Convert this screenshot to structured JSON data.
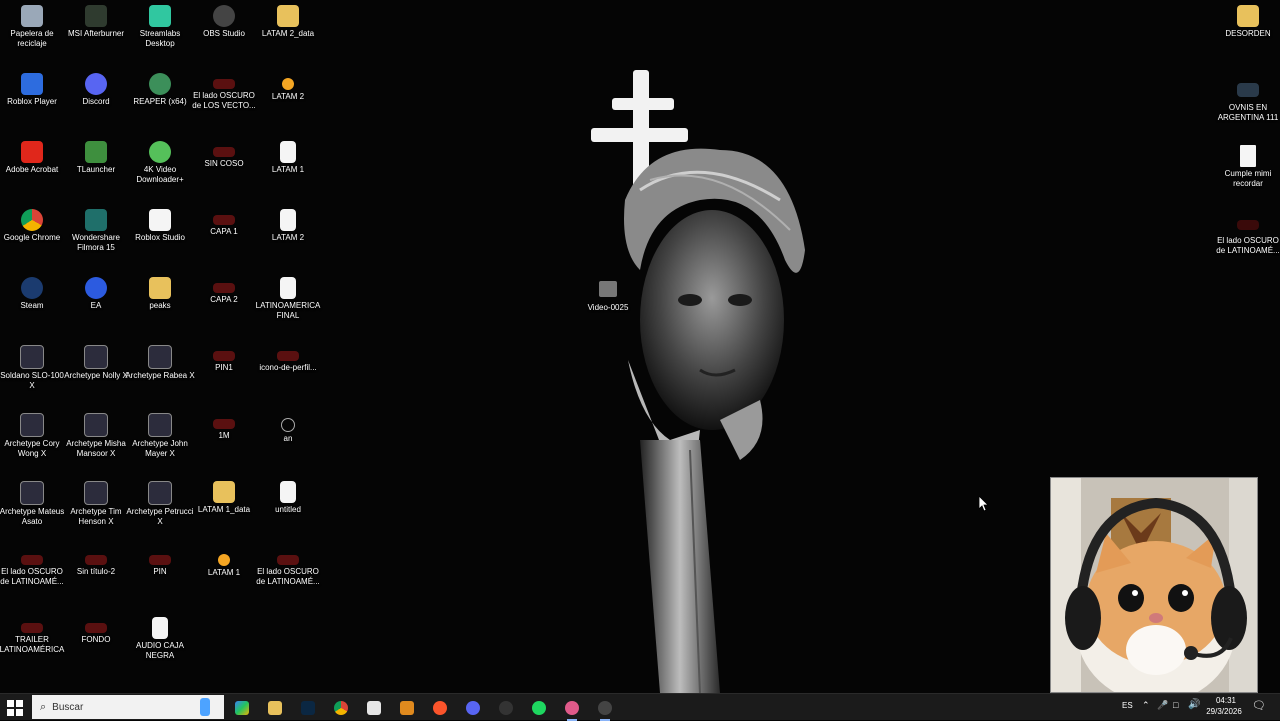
{
  "desktop": {
    "icons": [
      {
        "label": "Papelera de reciclaje",
        "icon": "recycle-bin-icon"
      },
      {
        "label": "MSI Afterburner",
        "icon": "afterburner-icon"
      },
      {
        "label": "Streamlabs Desktop",
        "icon": "streamlabs-icon"
      },
      {
        "label": "OBS Studio",
        "icon": "obs-icon"
      },
      {
        "label": "LATAM 2_data",
        "icon": "folder-icon"
      },
      {
        "label": "Roblox Player",
        "icon": "roblox-icon"
      },
      {
        "label": "Discord",
        "icon": "discord-icon"
      },
      {
        "label": "REAPER (x64)",
        "icon": "reaper-icon"
      },
      {
        "label": "El lado OSCURO de LOS VECTO...",
        "icon": "image-thumb-icon"
      },
      {
        "label": "LATAM 2",
        "icon": "project-icon"
      },
      {
        "label": "Adobe Acrobat",
        "icon": "acrobat-icon"
      },
      {
        "label": "TLauncher",
        "icon": "tlauncher-icon"
      },
      {
        "label": "4K Video Downloader+",
        "icon": "video-downloader-icon"
      },
      {
        "label": "SIN COSO",
        "icon": "image-thumb-icon"
      },
      {
        "label": "LATAM 1",
        "icon": "media-file-icon"
      },
      {
        "label": "Google Chrome",
        "icon": "chrome-icon"
      },
      {
        "label": "Wondershare Filmora 15",
        "icon": "filmora-icon"
      },
      {
        "label": "Roblox Studio",
        "icon": "roblox-studio-icon"
      },
      {
        "label": "CAPA 1",
        "icon": "image-thumb-icon"
      },
      {
        "label": "LATAM 2",
        "icon": "media-file-icon"
      },
      {
        "label": "Steam",
        "icon": "steam-icon"
      },
      {
        "label": "EA",
        "icon": "ea-icon"
      },
      {
        "label": "peaks",
        "icon": "folder-icon"
      },
      {
        "label": "CAPA 2",
        "icon": "image-thumb-icon"
      },
      {
        "label": "LATINOAMERICA FINAL",
        "icon": "media-file-icon"
      },
      {
        "label": "Soldano SLO-100 X",
        "icon": "archetype-icon"
      },
      {
        "label": "Archetype Nolly X",
        "icon": "archetype-icon"
      },
      {
        "label": "Archetype Rabea X",
        "icon": "archetype-icon"
      },
      {
        "label": "PIN1",
        "icon": "image-thumb-icon"
      },
      {
        "label": "icono-de-perfil...",
        "icon": "image-thumb-icon"
      },
      {
        "label": "Archetype Cory Wong X",
        "icon": "archetype-icon"
      },
      {
        "label": "Archetype Misha Mansoor X",
        "icon": "archetype-icon"
      },
      {
        "label": "Archetype John Mayer X",
        "icon": "archetype-icon"
      },
      {
        "label": "1M",
        "icon": "image-thumb-icon"
      },
      {
        "label": "an",
        "icon": "antenna-icon"
      },
      {
        "label": "Archetype Mateus Asato",
        "icon": "archetype-icon"
      },
      {
        "label": "Archetype Tim Henson X",
        "icon": "archetype-icon"
      },
      {
        "label": "Archetype Petrucci X",
        "icon": "archetype-icon"
      },
      {
        "label": "LATAM 1_data",
        "icon": "folder-icon"
      },
      {
        "label": "untitled",
        "icon": "media-file-icon"
      },
      {
        "label": "El lado OSCURO de LATINOAMÉ...",
        "icon": "image-thumb-icon"
      },
      {
        "label": "Sin título-2",
        "icon": "image-thumb-icon"
      },
      {
        "label": "PIN",
        "icon": "image-thumb-icon"
      },
      {
        "label": "LATAM 1",
        "icon": "project-icon"
      },
      {
        "label": "El lado OSCURO de LATINOAMÉ...",
        "icon": "image-thumb-icon"
      },
      {
        "label": "TRAILER LATINOAMÉRICA",
        "icon": "image-thumb-icon"
      },
      {
        "label": "FONDO",
        "icon": "image-thumb-icon"
      },
      {
        "label": "AUDIO CAJA NEGRA",
        "icon": "media-file-icon"
      }
    ],
    "right_icons": [
      {
        "label": "DESORDEN",
        "icon": "folder-icon"
      },
      {
        "label": "OVNIS EN ARGENTINA 111",
        "icon": "image-thumb-icon"
      },
      {
        "label": "Cumple mimi recordar",
        "icon": "text-file-icon"
      },
      {
        "label": "El lado OSCURO de LATINOAMÉ...",
        "icon": "image-thumb-icon"
      }
    ],
    "center_icon": {
      "label": "Video-0025",
      "icon": "video-file-icon"
    }
  },
  "taskbar": {
    "search_placeholder": "Buscar",
    "apps": [
      "copilot-icon",
      "file-explorer-icon",
      "photoshop-icon",
      "chrome-icon",
      "roblox-studio-icon",
      "tlauncher-icon",
      "brave-icon",
      "streamlabs-icon",
      "obs-icon",
      "spotify-icon",
      "chrome-profile-icon",
      "media-player-icon"
    ],
    "tray": {
      "language": "ES",
      "time": "04:31",
      "date": "29/3/2026"
    }
  },
  "colors": {
    "taskbar": "#1b1b1b",
    "folder": "#e8c15c",
    "spotify": "#1ed760",
    "discord": "#5865f2"
  }
}
